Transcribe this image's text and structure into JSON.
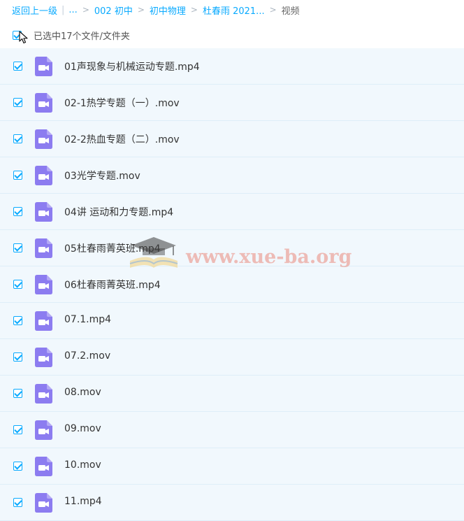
{
  "breadcrumb": {
    "back": "返回上一级",
    "ellipsis": "...",
    "items": [
      "002 初中",
      "初中物理",
      "杜春雨 2021..."
    ],
    "current": "视频"
  },
  "selection": {
    "label": "已选中17个文件/文件夹"
  },
  "files": [
    {
      "name": "01声现象与机械运动专题.mp4"
    },
    {
      "name": "02-1热学专题（一）.mov"
    },
    {
      "name": "02-2热血专题（二）.mov"
    },
    {
      "name": "03光学专题.mov"
    },
    {
      "name": "04讲 运动和力专题.mp4"
    },
    {
      "name": "05杜春雨菁英班.mp4"
    },
    {
      "name": "06杜春雨菁英班.mp4"
    },
    {
      "name": "07.1.mp4"
    },
    {
      "name": "07.2.mov"
    },
    {
      "name": "08.mov"
    },
    {
      "name": "09.mov"
    },
    {
      "name": "10.mov"
    },
    {
      "name": "11.mp4"
    }
  ],
  "watermark": {
    "text": "www.xue-ba.org"
  },
  "colors": {
    "accent": "#09aaff",
    "video_icon": "#8c7cf0",
    "row_bg": "#f1f8fd"
  },
  "icons": {
    "file": "video-file-icon",
    "cursor": "mouse-cursor-icon",
    "logo": "graduation-cap-book-icon"
  }
}
